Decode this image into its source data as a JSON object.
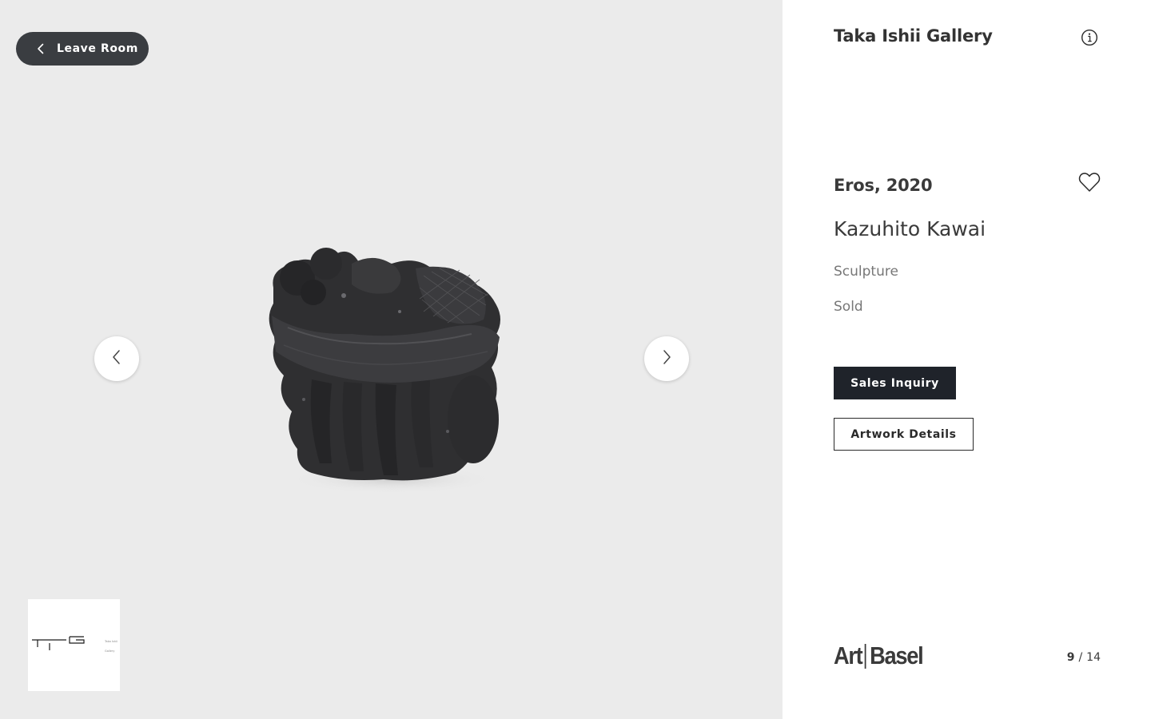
{
  "viewer": {
    "leave_label": "Leave Room",
    "thumbnail": {
      "logo_mark": "TIG",
      "caption_line1": "Taka Ishii",
      "caption_line2": "Gallery"
    }
  },
  "panel": {
    "gallery_name": "Taka Ishii Gallery",
    "artwork": {
      "title": "Eros, 2020",
      "artist": "Kazuhito Kawai",
      "medium": "Sculpture",
      "status": "Sold"
    },
    "actions": {
      "sales_inquiry": "Sales Inquiry",
      "artwork_details": "Artwork Details"
    },
    "logo": {
      "part1": "Art",
      "part2": "Basel"
    },
    "pager": {
      "current": "9",
      "separator": "/",
      "total": "14"
    }
  },
  "icons": {
    "back": "chevron-left-icon",
    "prev": "chevron-left-icon",
    "next": "chevron-right-icon",
    "info": "info-icon",
    "favorite": "heart-icon"
  },
  "colors": {
    "viewer_bg": "#ebebeb",
    "leave_button_bg": "#3a3d41",
    "primary_button_bg": "#1f232a",
    "text_dark": "#3a3a3a",
    "text_muted": "#777777"
  }
}
